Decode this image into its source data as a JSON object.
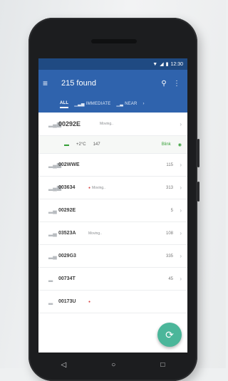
{
  "status": {
    "wifi_icon": "wifi-icon",
    "signal_icon": "cell-signal-icon",
    "battery_icon": "battery-icon",
    "time": "12:30"
  },
  "appbar": {
    "title": "215 found"
  },
  "tabs": [
    {
      "label": "ALL",
      "active": true
    },
    {
      "label": "IMMEDIATE",
      "active": false
    },
    {
      "label": "NEAR",
      "active": false
    }
  ],
  "devices": [
    {
      "id": "00292E",
      "tag": "Moving..",
      "dist": ""
    },
    {
      "id": "002WWE",
      "tag": "",
      "dist": "115"
    },
    {
      "id": "003634",
      "tag": "Moving..",
      "tag_dot": true,
      "dist": "313"
    },
    {
      "id": "00292E",
      "tag": "",
      "dist": "5"
    },
    {
      "id": "03523A",
      "tag": "Moving..",
      "dist": "108"
    },
    {
      "id": "0029G3",
      "tag": "",
      "dist": "335"
    },
    {
      "id": "00734T",
      "tag": "",
      "dist": "45"
    },
    {
      "id": "00173U",
      "tag": "",
      "tag_dot": true,
      "dist": ""
    }
  ],
  "detail": {
    "temp": "+2°C",
    "value": "147",
    "blink": "Blink"
  },
  "colors": {
    "appbar": "#2f63ad",
    "statusbar": "#1f4a82",
    "fab": "#4bb69a",
    "accent_green": "#3aa13c"
  }
}
